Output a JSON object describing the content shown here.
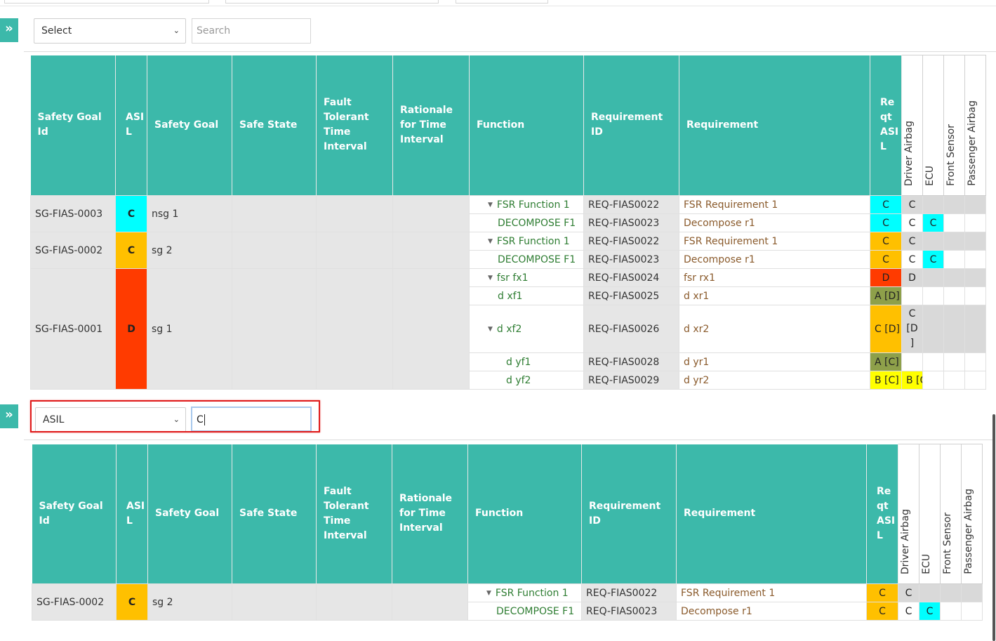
{
  "colors": {
    "teal": "#3cb9aa",
    "asil_c": "#00ffff",
    "asil_c_orange": "#ffc000",
    "asil_d": "#ff3b00",
    "asil_a": "#8ea04a",
    "asil_b": "#ffff00",
    "highlight": "#e01b1b"
  },
  "icons": {
    "expand": "double-chevron-right-icon",
    "dropdown": "chevron-down-icon",
    "tree": "triangle-down-icon"
  },
  "columns": {
    "safety_goal_id": "Safety Goal Id",
    "asil": "ASI L",
    "safety_goal": "Safety Goal",
    "safe_state": "Safe State",
    "ftti": "Fault Tolerant Time Interval",
    "rationale": "Rationale for Time Interval",
    "function": "Function",
    "requirement_id": "Requirement ID",
    "requirement": "Requirement",
    "req_asil": "Re qt ASI L",
    "alloc": [
      "Driver Airbag",
      "ECU",
      "Front Sensor",
      "Passenger Airbag"
    ]
  },
  "panel1": {
    "filter": {
      "select_value": "Select",
      "search_placeholder": "Search"
    },
    "goals": [
      {
        "id": "SG-FIAS-0003",
        "asil": "C",
        "goal": "nsg 1"
      },
      {
        "id": "SG-FIAS-0002",
        "asil": "C",
        "goal": "sg 2"
      },
      {
        "id": "SG-FIAS-0001",
        "asil": "D",
        "goal": "sg 1"
      }
    ],
    "rows": [
      {
        "function": "FSR Function 1",
        "req_id": "REQ-FIAS0022",
        "req": "FSR Requirement 1",
        "rasil": "C",
        "a1": "C",
        "a2": "",
        "a3": "",
        "a4": ""
      },
      {
        "function": "DECOMPOSE F1",
        "req_id": "REQ-FIAS0023",
        "req": "Decompose r1",
        "rasil": "C",
        "a1": "C",
        "a2": "C",
        "a3": "",
        "a4": ""
      },
      {
        "function": "FSR Function 1",
        "req_id": "REQ-FIAS0022",
        "req": "FSR Requirement 1",
        "rasil": "C",
        "a1": "C",
        "a2": "",
        "a3": "",
        "a4": ""
      },
      {
        "function": "DECOMPOSE F1",
        "req_id": "REQ-FIAS0023",
        "req": "Decompose r1",
        "rasil": "C",
        "a1": "C",
        "a2": "C",
        "a3": "",
        "a4": ""
      },
      {
        "function": "fsr fx1",
        "req_id": "REQ-FIAS0024",
        "req": "fsr rx1",
        "rasil": "D",
        "a1": "D",
        "a2": "",
        "a3": "",
        "a4": ""
      },
      {
        "function": "d xf1",
        "req_id": "REQ-FIAS0025",
        "req": "d xr1",
        "rasil": "A [D]",
        "a1": "",
        "a2": "",
        "a3": "",
        "a4": ""
      },
      {
        "function": "d xf2",
        "req_id": "REQ-FIAS0026",
        "req": "d xr2",
        "rasil": "C [D]",
        "a1": "C [D ]",
        "a2": "",
        "a3": "",
        "a4": ""
      },
      {
        "function": "d yf1",
        "req_id": "REQ-FIAS0028",
        "req": "d yr1",
        "rasil": "A [C]",
        "a1": "",
        "a2": "",
        "a3": "",
        "a4": ""
      },
      {
        "function": "d yf2",
        "req_id": "REQ-FIAS0029",
        "req": "d yr2",
        "rasil": "B [C]",
        "a1": "B [C]",
        "a2": "",
        "a3": "",
        "a4": ""
      }
    ]
  },
  "panel2": {
    "filter": {
      "select_value": "ASIL",
      "search_value": "C"
    },
    "goals": [
      {
        "id": "SG-FIAS-0002",
        "asil": "C",
        "goal": "sg 2"
      }
    ],
    "rows": [
      {
        "function": "FSR Function 1",
        "req_id": "REQ-FIAS0022",
        "req": "FSR Requirement 1",
        "rasil": "C",
        "a1": "C",
        "a2": "",
        "a3": "",
        "a4": ""
      },
      {
        "function": "DECOMPOSE F1",
        "req_id": "REQ-FIAS0023",
        "req": "Decompose r1",
        "rasil": "C",
        "a1": "C",
        "a2": "C",
        "a3": "",
        "a4": ""
      }
    ]
  }
}
